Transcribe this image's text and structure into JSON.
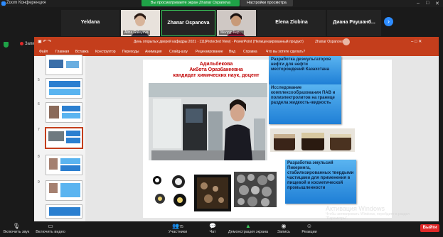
{
  "window": {
    "title": "Zoom Конференция"
  },
  "banner": {
    "sharing": "Вы просматриваете экран Zhanar Ospanova",
    "view_options": "Настройки просмотра"
  },
  "participants": [
    {
      "name": "Yeldana",
      "label": ""
    },
    {
      "name": "Alina Galeyeva",
      "label": "Alina Galeyeva"
    },
    {
      "name": "Zhanar Ospanova",
      "label": ""
    },
    {
      "name": "Мөлдір Кер...",
      "label": "Мөлдір Кер..."
    },
    {
      "name": "Elena Zlobina",
      "label": ""
    },
    {
      "name": "Диана Раушанб...",
      "label": ""
    }
  ],
  "recording": {
    "label": "Запись"
  },
  "ppt": {
    "doc_title": "День открытых дверей кафедры 2021 · 111[Protected View] · PowerPoint (Нелицензированный продукт)",
    "user": "Zhanar Ospanova",
    "tabs": [
      "Файл",
      "Главная",
      "Вставка",
      "Конструктор",
      "Переходы",
      "Анимация",
      "Слайд-шоу",
      "Рецензирование",
      "Вид",
      "Справка",
      "Что вы хотите сделать?"
    ],
    "thumb_numbers": [
      "5",
      "6",
      "7",
      "8",
      "9"
    ]
  },
  "slide": {
    "names": "Адильбекова\nАкбота Оразбакеевна\nкандидат химических наук, доцент",
    "box1": "Разработка деэмульгаторов нефти для  нефти месторождений Казахстана",
    "box2": "Исследование комплексообразования ПАВ и полиэлектролитов на границе раздела жидкость-жидкость",
    "box3": "Разработка эмульсий Пикеринга, стабилизированных твердыми частицами для применения в пищевой и косметической промышленности"
  },
  "watermark": {
    "title": "Активация Windows",
    "sub": "Чтобы активировать Windows, перейдите в раздел \"Параметры\"."
  },
  "toolbar": {
    "mute": "Включить звук",
    "video": "Включить видео",
    "participants": "Участники",
    "participants_count": "75",
    "chat": "Чат",
    "share": "Демонстрация экрана",
    "record": "Запись",
    "reactions": "Реакции",
    "end": "Выйти"
  }
}
